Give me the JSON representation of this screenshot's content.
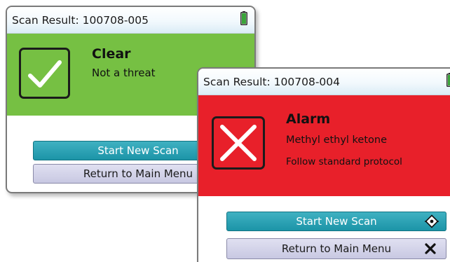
{
  "clear_screen": {
    "title": "Scan Result: 100708-005",
    "status": {
      "heading": "Clear",
      "line1": "Not a threat",
      "icon": "checkmark-icon",
      "color": "#76c043"
    },
    "buttons": {
      "primary": "Start New Scan",
      "secondary": "Return to Main Menu"
    }
  },
  "alarm_screen": {
    "title": "Scan Result: 100708-004",
    "status": {
      "heading": "Alarm",
      "line1": "Methyl ethyl ketone",
      "line2": "Follow standard protocol",
      "icon": "x-mark-icon",
      "color": "#e8202a"
    },
    "buttons": {
      "primary": "Start New Scan",
      "primary_icon": "target-diamond-icon",
      "secondary": "Return to Main Menu",
      "secondary_icon": "close-x-icon"
    }
  },
  "colors": {
    "primary_button": "#1c94a7",
    "secondary_button": "#c8c8e2",
    "battery": "#3aa53a"
  }
}
